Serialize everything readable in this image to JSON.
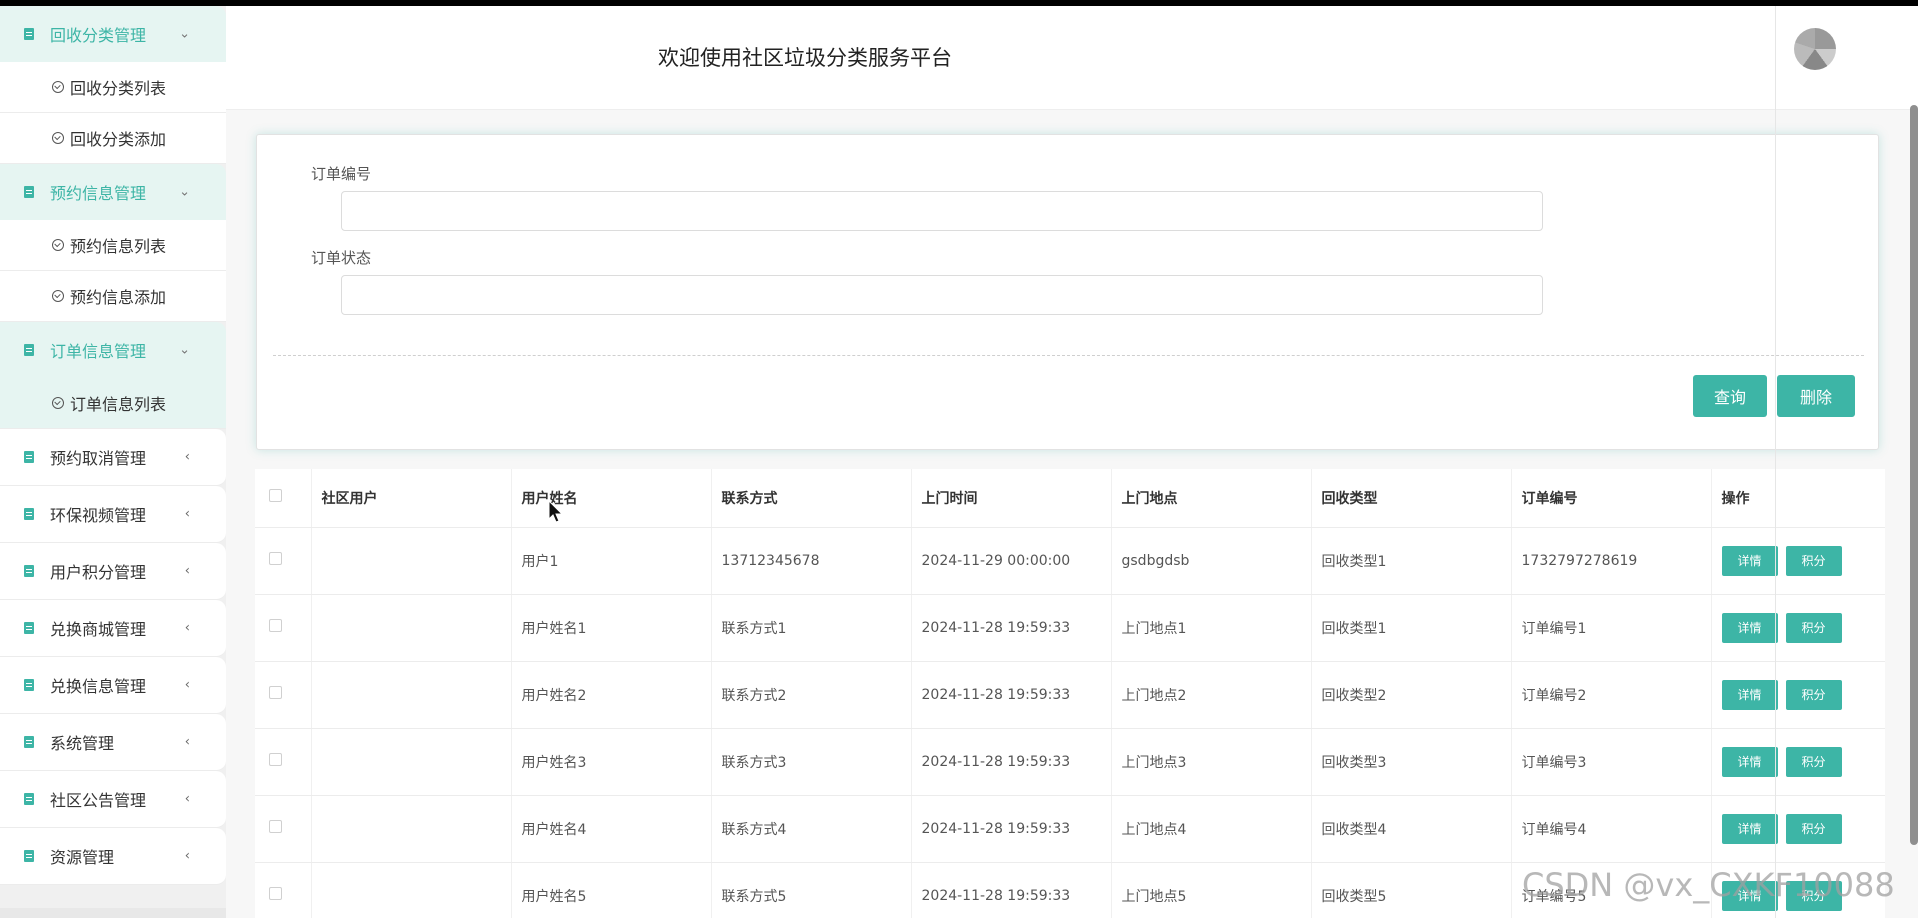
{
  "header": {
    "title": "欢迎使用社区垃圾分类服务平台"
  },
  "sidebar": {
    "groups": [
      {
        "label": "回收分类管理",
        "expanded": true,
        "items": [
          "回收分类列表",
          "回收分类添加"
        ]
      },
      {
        "label": "预约信息管理",
        "expanded": true,
        "items": [
          "预约信息列表",
          "预约信息添加"
        ]
      },
      {
        "label": "订单信息管理",
        "expanded": true,
        "items": [
          "订单信息列表"
        ]
      },
      {
        "label": "预约取消管理",
        "expanded": false
      },
      {
        "label": "环保视频管理",
        "expanded": false
      },
      {
        "label": "用户积分管理",
        "expanded": false
      },
      {
        "label": "兑换商城管理",
        "expanded": false
      },
      {
        "label": "兑换信息管理",
        "expanded": false
      },
      {
        "label": "系统管理",
        "expanded": false
      },
      {
        "label": "社区公告管理",
        "expanded": false
      },
      {
        "label": "资源管理",
        "expanded": false
      }
    ]
  },
  "search": {
    "order_no_label": "订单编号",
    "order_status_label": "订单状态",
    "order_no_value": "",
    "order_status_value": "",
    "query_label": "查询",
    "delete_label": "删除"
  },
  "table": {
    "columns": [
      "社区用户",
      "用户姓名",
      "联系方式",
      "上门时间",
      "上门地点",
      "回收类型",
      "订单编号",
      "操作"
    ],
    "rows": [
      [
        "",
        "用户1",
        "13712345678",
        "2024-11-29 00:00:00",
        "gsdbgdsb",
        "回收类型1",
        "1732797278619"
      ],
      [
        "",
        "用户姓名1",
        "联系方式1",
        "2024-11-28 19:59:33",
        "上门地点1",
        "回收类型1",
        "订单编号1"
      ],
      [
        "",
        "用户姓名2",
        "联系方式2",
        "2024-11-28 19:59:33",
        "上门地点2",
        "回收类型2",
        "订单编号2"
      ],
      [
        "",
        "用户姓名3",
        "联系方式3",
        "2024-11-28 19:59:33",
        "上门地点3",
        "回收类型3",
        "订单编号3"
      ],
      [
        "",
        "用户姓名4",
        "联系方式4",
        "2024-11-28 19:59:33",
        "上门地点4",
        "回收类型4",
        "订单编号4"
      ],
      [
        "",
        "用户姓名5",
        "联系方式5",
        "2024-11-28 19:59:33",
        "上门地点5",
        "回收类型5",
        "订单编号5"
      ]
    ],
    "detail_label": "详情",
    "points_label": "积分"
  },
  "watermark": "CSDN @vx_CXKF10088",
  "colors": {
    "accent": "#3db5a6",
    "sidebar_active_bg": "#e6f5f2"
  },
  "icons": {
    "group": "doc-icon",
    "item": "check-circle-icon",
    "expanded": "chevron-down-icon",
    "collapsed": "chevron-left-icon"
  }
}
